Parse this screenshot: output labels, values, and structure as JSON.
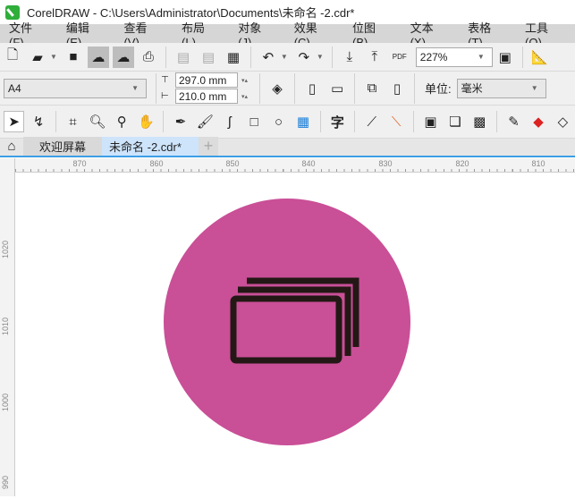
{
  "window": {
    "title": "CorelDRAW - C:\\Users\\Administrator\\Documents\\未命名 -2.cdr*"
  },
  "menu": [
    "文件(F)",
    "编辑(E)",
    "查看(V)",
    "布局(L)",
    "对象(J)",
    "效果(C)",
    "位图(B)",
    "文本(X)",
    "表格(T)",
    "工具(O)"
  ],
  "toolbar": {
    "zoom_value": "227%",
    "pdf_label": "PDF"
  },
  "property_bar": {
    "page_size": "A4",
    "height": "297.0 mm",
    "width": "210.0 mm",
    "units_label": "单位:",
    "units_value": "毫米"
  },
  "toolbox": {
    "text_tool": "字"
  },
  "tabs": [
    {
      "label": "欢迎屏幕"
    },
    {
      "label": "未命名 -2.cdr*",
      "active": true
    }
  ],
  "rulers": {
    "horizontal": [
      "870",
      "860",
      "850",
      "840",
      "830",
      "820",
      "810"
    ],
    "vertical": [
      "1020",
      "1010",
      "1000",
      "990"
    ]
  },
  "artwork": {
    "circle_color": "#c94f97",
    "icon_color": "#231815",
    "icon": "stacked-cards-icon"
  },
  "colors": {
    "accent": "#3c9ee6"
  }
}
